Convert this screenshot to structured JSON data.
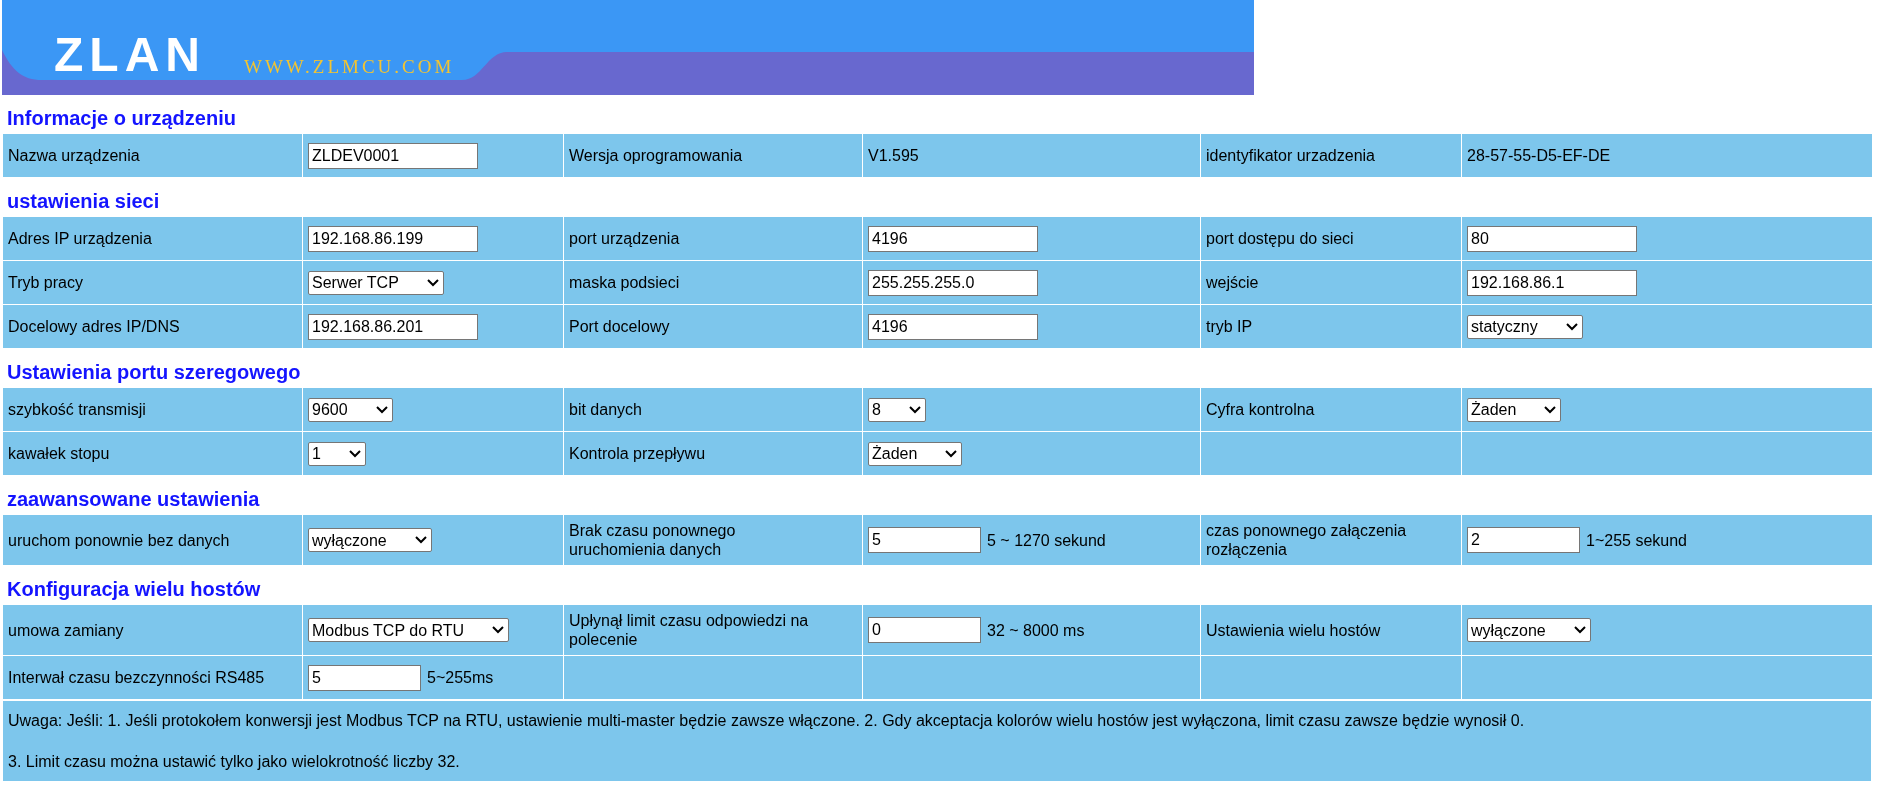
{
  "header": {
    "logo": "ZLAN",
    "url": "WWW.ZLMCU.COM"
  },
  "sections": [
    {
      "title": "Informacje o urządzeniu",
      "rows": [
        [
          {
            "kind": "label",
            "text": "Nazwa urządzenia"
          },
          {
            "kind": "input",
            "value": "ZLDEV0001"
          },
          {
            "kind": "label",
            "text": "Wersja oprogramowania"
          },
          {
            "kind": "text",
            "text": "V1.595"
          },
          {
            "kind": "label",
            "text": "identyfikator urzadzenia"
          },
          {
            "kind": "text",
            "text": "28-57-55-D5-EF-DE"
          }
        ]
      ]
    },
    {
      "title": "ustawienia sieci",
      "rows": [
        [
          {
            "kind": "label",
            "text": "Adres IP urządzenia"
          },
          {
            "kind": "input",
            "value": "192.168.86.199"
          },
          {
            "kind": "label",
            "text": "port urządzenia"
          },
          {
            "kind": "input",
            "value": "4196"
          },
          {
            "kind": "label",
            "text": "port dostępu do sieci"
          },
          {
            "kind": "input",
            "value": "80"
          }
        ],
        [
          {
            "kind": "label",
            "text": "Tryb pracy"
          },
          {
            "kind": "select",
            "value": "Serwer TCP"
          },
          {
            "kind": "label",
            "text": "maska podsieci"
          },
          {
            "kind": "input",
            "value": "255.255.255.0"
          },
          {
            "kind": "label",
            "text": "wejście"
          },
          {
            "kind": "input",
            "value": "192.168.86.1"
          }
        ],
        [
          {
            "kind": "label",
            "text": "Docelowy adres IP/DNS"
          },
          {
            "kind": "input",
            "value": "192.168.86.201"
          },
          {
            "kind": "label",
            "text": "Port docelowy"
          },
          {
            "kind": "input",
            "value": "4196"
          },
          {
            "kind": "label",
            "text": "tryb IP"
          },
          {
            "kind": "select",
            "value": "statyczny"
          }
        ]
      ]
    },
    {
      "title": "Ustawienia portu szeregowego",
      "rows": [
        [
          {
            "kind": "label",
            "text": "szybkość transmisji"
          },
          {
            "kind": "select",
            "value": "9600"
          },
          {
            "kind": "label",
            "text": "bit danych"
          },
          {
            "kind": "select",
            "value": "8"
          },
          {
            "kind": "label",
            "text": "Cyfra kontrolna"
          },
          {
            "kind": "select",
            "value": "Żaden"
          }
        ],
        [
          {
            "kind": "label",
            "text": "kawałek stopu"
          },
          {
            "kind": "select",
            "value": "1"
          },
          {
            "kind": "label",
            "text": "Kontrola przepływu"
          },
          {
            "kind": "select",
            "value": "Żaden"
          },
          {
            "kind": "empty"
          },
          {
            "kind": "empty"
          }
        ]
      ]
    },
    {
      "title": "zaawansowane ustawienia",
      "rows": [
        [
          {
            "kind": "label",
            "text": "uruchom ponownie bez danych"
          },
          {
            "kind": "select",
            "value": "wyłączone"
          },
          {
            "kind": "label",
            "text": "Brak czasu ponownego uruchomienia danych"
          },
          {
            "kind": "input",
            "value": "5",
            "suffix": "5 ~ 1270 sekund"
          },
          {
            "kind": "label",
            "text": "czas ponownego załączenia rozłączenia"
          },
          {
            "kind": "input",
            "value": "2",
            "suffix": "1~255 sekund"
          }
        ]
      ]
    },
    {
      "title": "Konfiguracja wielu hostów",
      "rows": [
        [
          {
            "kind": "label",
            "text": "umowa zamiany"
          },
          {
            "kind": "select",
            "value": "Modbus TCP do RTU"
          },
          {
            "kind": "label",
            "text": "Upłynął limit czasu odpowiedzi na polecenie"
          },
          {
            "kind": "input",
            "value": "0",
            "suffix": "32 ~ 8000 ms"
          },
          {
            "kind": "label",
            "text": "Ustawienia wielu hostów"
          },
          {
            "kind": "select",
            "value": "wyłączone"
          }
        ],
        [
          {
            "kind": "label",
            "text": "Interwał czasu bezczynności RS485"
          },
          {
            "kind": "input",
            "value": "5",
            "suffix": "5~255ms"
          },
          {
            "kind": "empty"
          },
          {
            "kind": "empty"
          },
          {
            "kind": "empty"
          },
          {
            "kind": "empty"
          }
        ]
      ]
    }
  ],
  "note": [
    "Uwaga: Jeśli: 1. Jeśli protokołem konwersji jest Modbus TCP na RTU, ustawienie multi-master będzie zawsze włączone. 2. Gdy akceptacja kolorów wielu hostów jest wyłączona, limit czasu zawsze będzie wynosił 0.",
    "3. Limit czasu można ustawić tylko jako wielokrotność liczby 32."
  ]
}
